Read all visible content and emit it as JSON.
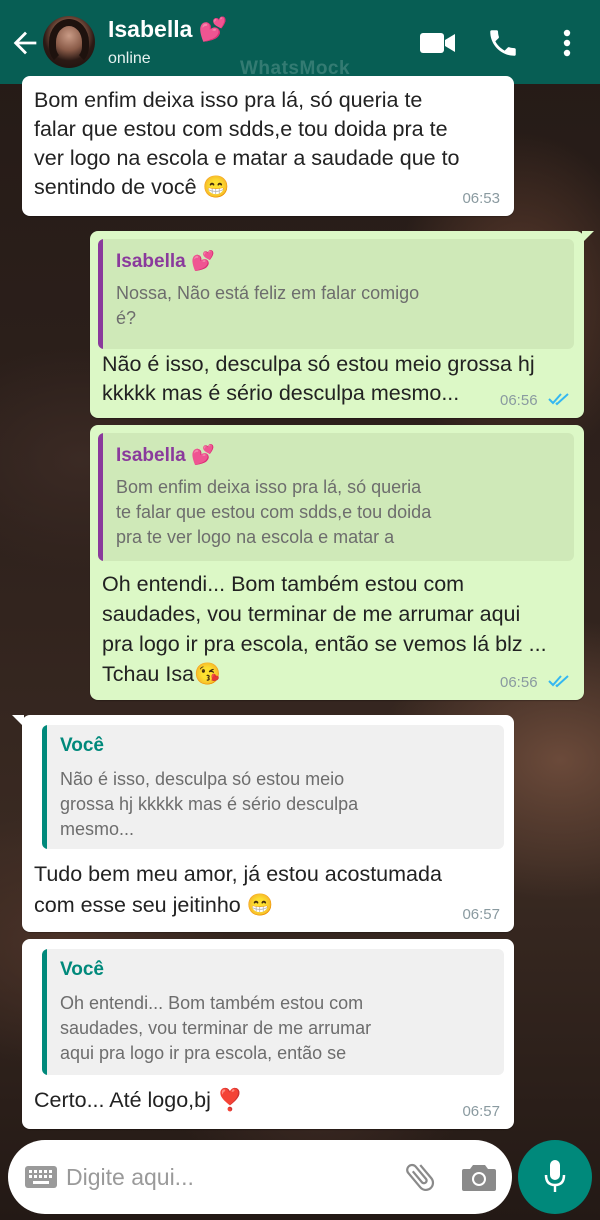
{
  "header": {
    "contact_name": "Isabella 💕",
    "status": "online",
    "watermark": "WhatsMock"
  },
  "messages": [
    {
      "direction": "incoming",
      "text": "Bom enfim deixa isso pra lá, só queria te\nfalar que estou com sdds,e tou doida pra te\nver logo na escola e matar a saudade que to\nsentindo de você 😁",
      "time": "06:53"
    },
    {
      "direction": "outgoing",
      "quote_name": "Isabella 💕",
      "quote_text": "Nossa, Não está feliz em falar comigo\né?",
      "text": "Não é isso, desculpa só estou meio grossa hj\nkkkkk mas é sério desculpa mesmo...",
      "time": "06:56",
      "read": true
    },
    {
      "direction": "outgoing",
      "quote_name": "Isabella 💕",
      "quote_text": "Bom enfim deixa isso pra lá, só queria\nte falar que estou com sdds,e tou doida\npra te ver logo na escola e matar a",
      "text": "Oh entendi... Bom também estou com\nsaudades, vou terminar de me arrumar aqui\npra logo ir pra escola, então se vemos lá blz ...\nTchau Isa😘",
      "time": "06:56",
      "read": true
    },
    {
      "direction": "incoming",
      "quote_name": "Você",
      "quote_text": "Não é isso, desculpa só estou meio\ngrossa hj kkkkk mas é sério desculpa\nmesmo...",
      "text": "Tudo bem meu amor, já estou acostumada\ncom esse seu jeitinho 😁",
      "time": "06:57"
    },
    {
      "direction": "incoming",
      "quote_name": "Você",
      "quote_text": "Oh entendi... Bom também estou com\nsaudades, vou terminar de me arrumar\naqui pra logo ir pra escola, então se",
      "text": "Certo... Até logo,bj ❣️",
      "time": "06:57"
    }
  ],
  "input": {
    "placeholder": "Digite aqui..."
  },
  "colors": {
    "header": "#075e54",
    "outgoing_bubble": "#dcf8c6",
    "incoming_bubble": "#ffffff",
    "read_ticks": "#34b7f1",
    "mic_button": "#00897b"
  },
  "icons": [
    "back-arrow-icon",
    "video-call-icon",
    "phone-icon",
    "more-vert-icon",
    "keyboard-icon",
    "attach-icon",
    "camera-icon",
    "mic-icon",
    "double-check-icon"
  ]
}
